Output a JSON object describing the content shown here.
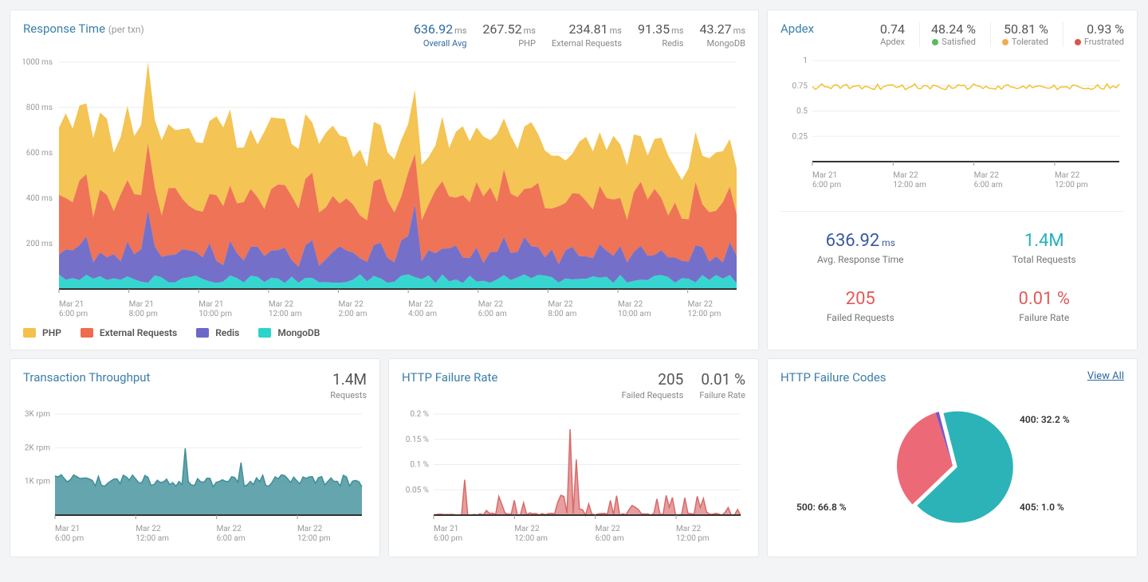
{
  "response_time": {
    "title": "Response Time",
    "subtitle": "(per txn)",
    "stats": [
      {
        "value": "636.92",
        "unit": "ms",
        "label": "Overall Avg",
        "blue": true
      },
      {
        "value": "267.52",
        "unit": "ms",
        "label": "PHP"
      },
      {
        "value": "234.81",
        "unit": "ms",
        "label": "External Requests"
      },
      {
        "value": "91.35",
        "unit": "ms",
        "label": "Redis"
      },
      {
        "value": "43.27",
        "unit": "ms",
        "label": "MongoDB"
      }
    ],
    "y_ticks": [
      "200 ms",
      "400 ms",
      "600 ms",
      "800 ms",
      "1000 ms"
    ],
    "x_ticks": [
      {
        "d": "Mar 21",
        "t": "6:00 pm"
      },
      {
        "d": "Mar 21",
        "t": "8:00 pm"
      },
      {
        "d": "Mar 21",
        "t": "10:00 pm"
      },
      {
        "d": "Mar 22",
        "t": "12:00 am"
      },
      {
        "d": "Mar 22",
        "t": "2:00 am"
      },
      {
        "d": "Mar 22",
        "t": "4:00 am"
      },
      {
        "d": "Mar 22",
        "t": "6:00 am"
      },
      {
        "d": "Mar 22",
        "t": "8:00 am"
      },
      {
        "d": "Mar 22",
        "t": "10:00 am"
      },
      {
        "d": "Mar 22",
        "t": "12:00 pm"
      }
    ],
    "legend": [
      {
        "name": "PHP",
        "color": "#f3c14b"
      },
      {
        "name": "External Requests",
        "color": "#ee6c4d"
      },
      {
        "name": "Redis",
        "color": "#6d68c6"
      },
      {
        "name": "MongoDB",
        "color": "#2cd3cc"
      }
    ]
  },
  "apdex": {
    "title": "Apdex",
    "stats": [
      {
        "value": "0.74",
        "label": "Apdex"
      },
      {
        "value": "48.24 %",
        "label": "Satisfied",
        "dot": "#5cb85c"
      },
      {
        "value": "50.81 %",
        "label": "Tolerated",
        "dot": "#f0ad4e"
      },
      {
        "value": "0.93 %",
        "label": "Frustrated",
        "dot": "#d9534f"
      }
    ],
    "y_ticks": [
      "0.25",
      "0.5",
      "0.75",
      "1"
    ],
    "x_ticks": [
      {
        "d": "Mar 21",
        "t": "6:00 pm"
      },
      {
        "d": "Mar 22",
        "t": "12:00 am"
      },
      {
        "d": "Mar 22",
        "t": "6:00 am"
      },
      {
        "d": "Mar 22",
        "t": "12:00 pm"
      }
    ],
    "big": [
      {
        "value": "636.92",
        "unit": "ms",
        "label": "Avg. Response Time",
        "color": "c-blue"
      },
      {
        "value": "1.4M",
        "unit": "",
        "label": "Total Requests",
        "color": "c-cyan"
      },
      {
        "value": "205",
        "unit": "",
        "label": "Failed Requests",
        "color": "c-red"
      },
      {
        "value": "0.01 %",
        "unit": "",
        "label": "Failure Rate",
        "color": "c-red"
      }
    ]
  },
  "throughput": {
    "title": "Transaction Throughput",
    "stats": [
      {
        "value": "1.4M",
        "label": "Requests"
      }
    ],
    "y_ticks": [
      "1K rpm",
      "2K rpm",
      "3K rpm"
    ],
    "x_ticks": [
      {
        "d": "Mar 21",
        "t": "6:00 pm"
      },
      {
        "d": "Mar 22",
        "t": "12:00 am"
      },
      {
        "d": "Mar 22",
        "t": "6:00 am"
      },
      {
        "d": "Mar 22",
        "t": "12:00 pm"
      }
    ]
  },
  "failure_rate": {
    "title": "HTTP Failure Rate",
    "stats": [
      {
        "value": "205",
        "label": "Failed Requests"
      },
      {
        "value": "0.01 %",
        "label": "Failure Rate"
      }
    ],
    "y_ticks": [
      "0.05 %",
      "0.1 %",
      "0.15 %",
      "0.2 %"
    ],
    "x_ticks": [
      {
        "d": "Mar 21",
        "t": "6:00 pm"
      },
      {
        "d": "Mar 22",
        "t": "12:00 am"
      },
      {
        "d": "Mar 22",
        "t": "6:00 am"
      },
      {
        "d": "Mar 22",
        "t": "12:00 pm"
      }
    ]
  },
  "failure_codes": {
    "title": "HTTP Failure Codes",
    "view_all": "View All",
    "slices": [
      {
        "label": "500: 66.8 %",
        "value": 66.8,
        "color": "#2bb3b8"
      },
      {
        "label": "400: 32.2 %",
        "value": 32.2,
        "color": "#ec6a78"
      },
      {
        "label": "405: 1.0 %",
        "value": 1.0,
        "color": "#7e57c2"
      }
    ]
  },
  "chart_data": [
    {
      "type": "area",
      "title": "Response Time (per txn)",
      "ylabel": "ms",
      "ylim": [
        0,
        1000
      ],
      "stacked": true,
      "x": [
        "Mar21 6pm",
        "Mar21 8pm",
        "Mar21 10pm",
        "Mar22 12am",
        "Mar22 2am",
        "Mar22 4am",
        "Mar22 6am",
        "Mar22 8am",
        "Mar22 10am",
        "Mar22 12pm"
      ],
      "series": [
        {
          "name": "MongoDB",
          "color": "#2cd3cc",
          "values": [
            45,
            50,
            48,
            45,
            50,
            60,
            50,
            45,
            48,
            45
          ]
        },
        {
          "name": "Redis",
          "color": "#6d68c6",
          "values": [
            130,
            180,
            150,
            120,
            140,
            260,
            130,
            120,
            130,
            120
          ]
        },
        {
          "name": "External Requests",
          "color": "#ee6c4d",
          "values": [
            260,
            310,
            280,
            260,
            250,
            280,
            220,
            220,
            230,
            220
          ]
        },
        {
          "name": "PHP",
          "color": "#f3c14b",
          "values": [
            360,
            420,
            350,
            320,
            300,
            320,
            240,
            240,
            250,
            230
          ]
        }
      ]
    },
    {
      "type": "line",
      "title": "Apdex",
      "ylim": [
        0,
        1
      ],
      "x": [
        "Mar21 6pm",
        "Mar22 12am",
        "Mar22 6am",
        "Mar22 12pm"
      ],
      "series": [
        {
          "name": "Apdex",
          "color": "#f0c330",
          "values": [
            0.73,
            0.74,
            0.76,
            0.75
          ]
        }
      ]
    },
    {
      "type": "area",
      "title": "Transaction Throughput",
      "ylabel": "rpm",
      "ylim": [
        0,
        3000
      ],
      "x": [
        "Mar21 6pm",
        "Mar22 12am",
        "Mar22 6am",
        "Mar22 12pm"
      ],
      "series": [
        {
          "name": "Throughput",
          "color": "#3f8f99",
          "values": [
            1000,
            1050,
            1100,
            1050
          ]
        }
      ]
    },
    {
      "type": "area",
      "title": "HTTP Failure Rate",
      "ylabel": "%",
      "ylim": [
        0,
        0.2
      ],
      "x": [
        "Mar21 6pm",
        "Mar22 12am",
        "Mar22 6am",
        "Mar22 12pm"
      ],
      "series": [
        {
          "name": "Failure Rate",
          "color": "#d96a6a",
          "values": [
            0.01,
            0.0,
            0.06,
            0.02
          ]
        }
      ]
    },
    {
      "type": "pie",
      "title": "HTTP Failure Codes",
      "series": [
        {
          "name": "500",
          "value": 66.8,
          "color": "#2bb3b8"
        },
        {
          "name": "400",
          "value": 32.2,
          "color": "#ec6a78"
        },
        {
          "name": "405",
          "value": 1.0,
          "color": "#7e57c2"
        }
      ]
    }
  ]
}
